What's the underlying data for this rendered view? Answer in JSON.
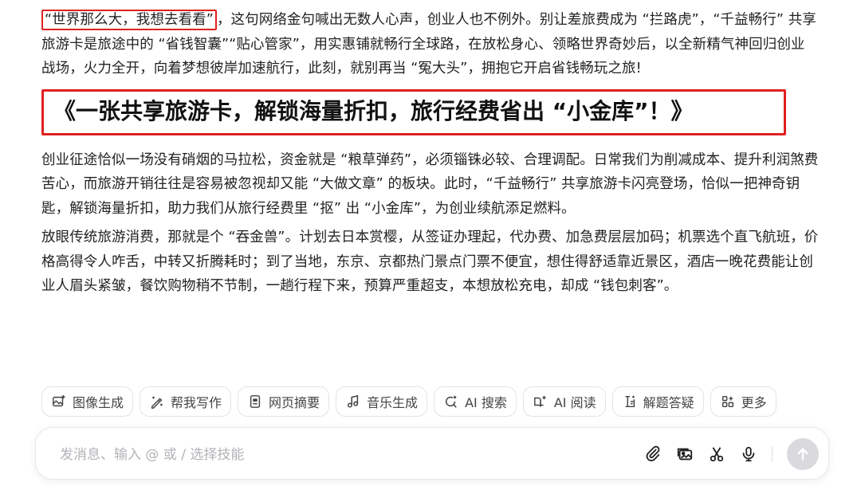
{
  "article": {
    "p1_quote": "“世界那么大，我想去看看”",
    "p1_rest": "，这句网络金句喊出无数人心声，创业人也不例外。别让差旅费成为 “拦路虎”，“千益畅行” 共享旅游卡是旅途中的 “省钱智囊”“贴心管家”，用实惠铺就畅行全球路，在放松身心、领略世界奇妙后，以全新精气神回归创业战场，火力全开，向着梦想彼岸加速航行，此刻，就别再当 “冤大头”，拥抱它开启省钱畅玩之旅!",
    "headline": "《一张共享旅游卡，解锁海量折扣，旅行经费省出 “小金库”！》",
    "p2": "创业征途恰似一场没有硝烟的马拉松，资金就是 “粮草弹药”，必须锱铢必较、合理调配。日常我们为削减成本、提升利润煞费苦心，而旅游开销往往是容易被忽视却又能 “大做文章” 的板块。此时，“千益畅行” 共享旅游卡闪亮登场，恰似一把神奇钥匙，解锁海量折扣，助力我们从旅行经费里 “抠” 出 “小金库”，为创业续航添足燃料。",
    "p3": "放眼传统旅游消费，那就是个 “吞金兽”。计划去日本赏樱，从签证办理起，代办费、加急费层层加码；机票选个直飞航班，价格高得令人咋舌，中转又折腾耗时；到了当地，东京、京都热门景点门票不便宜，想住得舒适靠近景区，酒店一晚花费能让创业人眉头紧皱，餐饮购物稍不节制，一趟行程下来，预算严重超支，本想放松充电，却成 “钱包刺客”。"
  },
  "toolbar": {
    "items": [
      {
        "label": "图像生成",
        "icon": "image-plus-icon"
      },
      {
        "label": "帮我写作",
        "icon": "pen-sparkle-icon"
      },
      {
        "label": "网页摘要",
        "icon": "document-icon"
      },
      {
        "label": "音乐生成",
        "icon": "music-note-icon"
      },
      {
        "label": "AI 搜索",
        "icon": "search-sparkle-icon"
      },
      {
        "label": "AI 阅读",
        "icon": "book-sparkle-icon"
      },
      {
        "label": "解题答疑",
        "icon": "homework-icon"
      },
      {
        "label": "更多",
        "icon": "grid-plus-icon"
      }
    ]
  },
  "composer": {
    "placeholder": "发消息、输入 @ 或 / 选择技能"
  },
  "colors": {
    "highlight_border": "#e02020",
    "text": "#222222",
    "placeholder": "#b3b3b8",
    "send_button": "#d9d9de"
  }
}
